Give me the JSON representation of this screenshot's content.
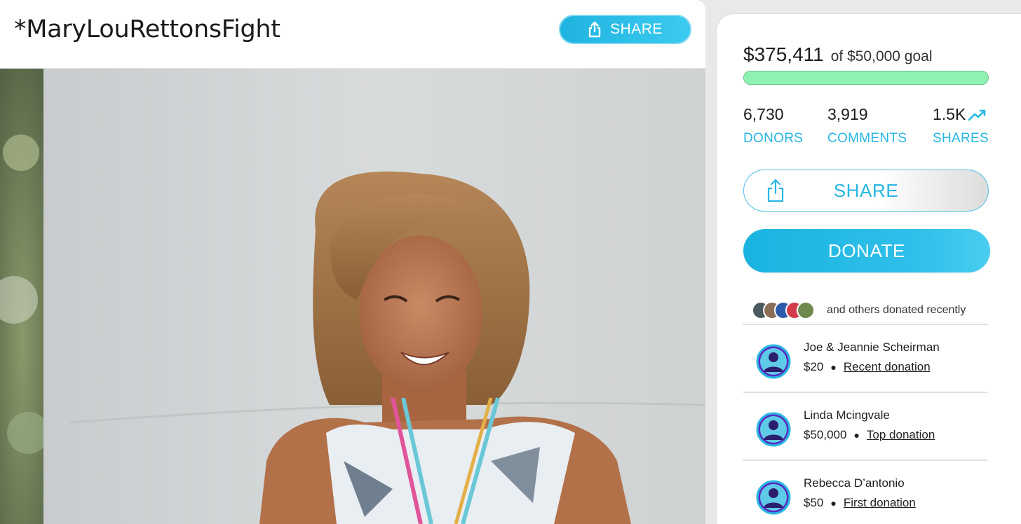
{
  "campaign": {
    "title": "*MaryLouRettonsFight",
    "share_label": "SHARE"
  },
  "photo": {
    "icon": "campaign-photo"
  },
  "progress": {
    "raised": "$375,411",
    "goal_text": "of $50,000 goal",
    "fill_fraction": 1.0,
    "bar_color": "#8ff2b3"
  },
  "stats": {
    "donors": {
      "value": "6,730",
      "label": "DONORS"
    },
    "comments": {
      "value": "3,919",
      "label": "COMMENTS"
    },
    "shares": {
      "value": "1.5K",
      "label": "SHARES",
      "icon": "trending-up-icon"
    }
  },
  "buttons": {
    "share": "SHARE",
    "donate": "DONATE"
  },
  "recent": {
    "text": "and others donated recently"
  },
  "donations": [
    {
      "name": "Joe & Jeannie Scheirman",
      "amount": "$20",
      "type": "Recent donation"
    },
    {
      "name": "Linda Mcingvale",
      "amount": "$50,000",
      "type": "Top donation"
    },
    {
      "name": "Rebecca D’antonio",
      "amount": "$50",
      "type": "First donation"
    }
  ],
  "colors": {
    "accent": "#26b6e3",
    "donate_start": "#1ab3e0",
    "progress": "#8ff2b3"
  }
}
